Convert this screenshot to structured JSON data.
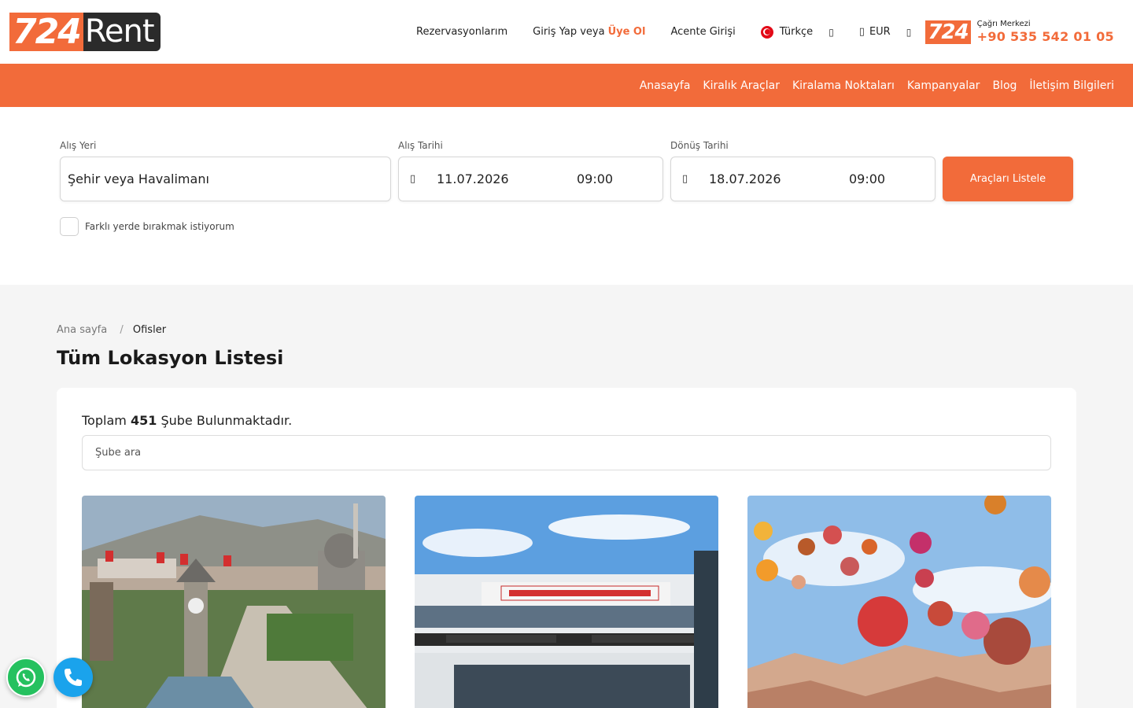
{
  "header": {
    "logo": {
      "num": "724",
      "word": "Rent"
    },
    "nav": {
      "reservations": "Rezervasyonlarım",
      "login": "Giriş Yap veya",
      "register": "Üye Ol",
      "agency": "Acente Girişi",
      "language": "Türkçe",
      "currency": "EUR"
    },
    "callcenter": {
      "badge": "724",
      "label": "Çağrı Merkezi",
      "phone": "+90 535 542 01 05"
    }
  },
  "mainnav": [
    "Anasayfa",
    "Kiralık Araçlar",
    "Kiralama Noktaları",
    "Kampanyalar",
    "Blog",
    "İletişim Bilgileri"
  ],
  "search": {
    "pickup_label": "Alış Yeri",
    "pickup_value": "Şehir veya Havalimanı",
    "pickup_date_label": "Alış Tarihi",
    "pickup_date": "11.07.2026",
    "pickup_time": "09:00",
    "return_date_label": "Dönüş Tarihi",
    "return_date": "18.07.2026",
    "return_time": "09:00",
    "button": "Araçları Listele",
    "different_return": "Farklı yerde bırakmak istiyorum"
  },
  "breadcrumb": {
    "home": "Ana sayfa",
    "sep": "/",
    "current": "Ofisler"
  },
  "page_title": "Tüm Lokasyon Listesi",
  "list": {
    "total_prefix": "Toplam",
    "total_count": "451",
    "total_suffix": "Şube Bulunmaktadır.",
    "search_placeholder": "Şube ara"
  },
  "colors": {
    "accent": "#f26b3a",
    "dark": "#2b2b2b",
    "whatsapp": "#25c15f",
    "phone": "#1aa3ec"
  },
  "icons": [
    "turkey-flag-icon",
    "chevron-down-icon",
    "wallet-icon",
    "calendar-icon",
    "whatsapp-icon",
    "phone-icon"
  ]
}
